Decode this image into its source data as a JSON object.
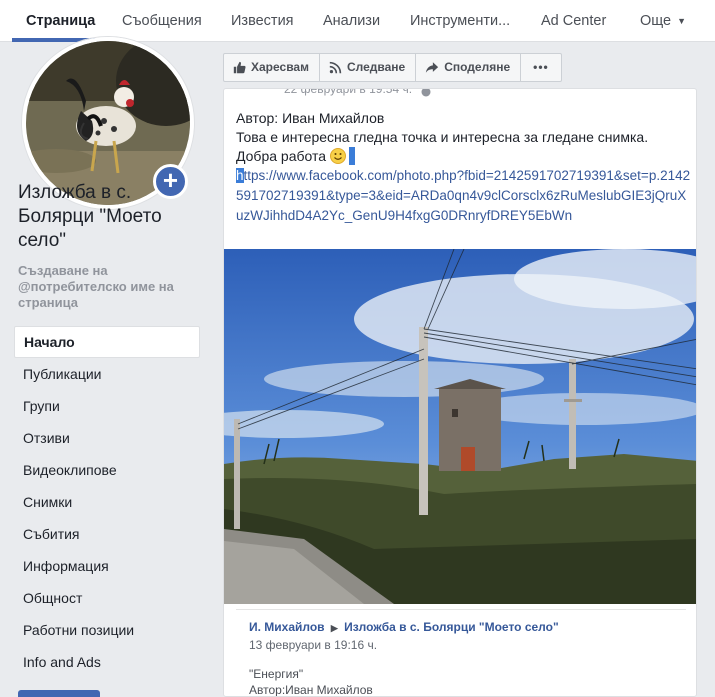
{
  "nav": {
    "items": [
      "Страница",
      "Съобщения",
      "Известия",
      "Анализи",
      "Инструменти...",
      "Ad Center",
      "Още"
    ],
    "caret": "▼"
  },
  "sidebar": {
    "page_name": "Изложба в с. Болярци \"Моето село\"",
    "create_username": "Създаване на @потребителско име на страница",
    "plus": "+",
    "items": [
      "Начало",
      "Публикации",
      "Групи",
      "Отзиви",
      "Видеоклипове",
      "Снимки",
      "Събития",
      "Информация",
      "Общност",
      "Работни позиции",
      "Info and Ads"
    ]
  },
  "actions": {
    "like": "Харесвам",
    "follow": "Следване",
    "share": "Споделяне",
    "more": "•••"
  },
  "post": {
    "date_partial": "22 февруари в 19:54 ч.",
    "author_line": "Автор: Иван Михайлов",
    "text_line": "Това е интересна гледна точка и интересна за гледане снимка.",
    "good_job": "Добра работа",
    "link_first_char": "h",
    "link_rest": "ttps://www.facebook.com/photo.php?fbid=2142591702719391&set=p.2142591702719391&type=3&eid=ARDa0qn4v9clCorsclx6zRuMeslubGIE3jQruXuzWJihhdD4A2Yc_GenU9H4fxgG0DRnryfDREY5EbWn"
  },
  "shared": {
    "author": "И. Михайлов",
    "arrow": "▶",
    "page": "Изложба в с. Болярци \"Моето село\"",
    "date": "13 февруари в 19:16 ч.",
    "title": "\"Енергия\"",
    "author_line": "Автор:Иван Михайлов"
  },
  "colors": {
    "accent": "#4267b2",
    "link": "#365899",
    "background": "#e9ebee"
  }
}
